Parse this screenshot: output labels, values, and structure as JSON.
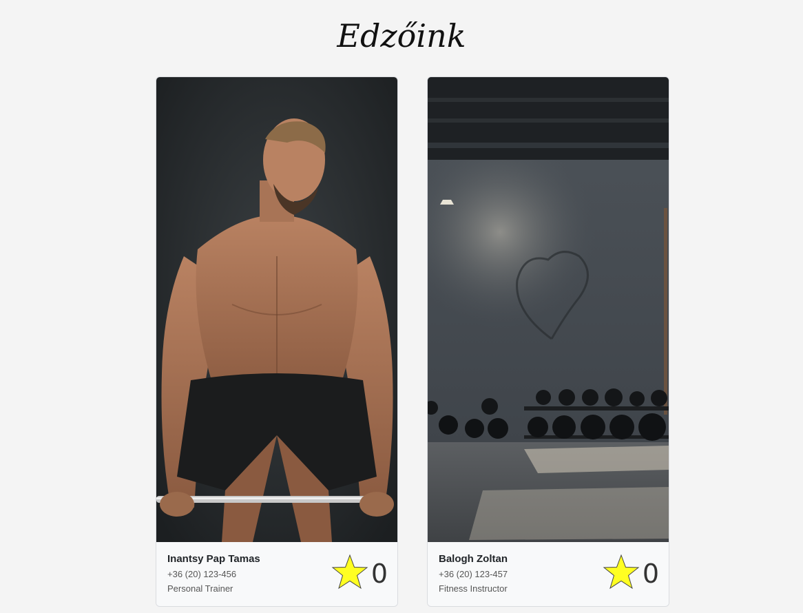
{
  "page": {
    "title": "Edzőink"
  },
  "trainers": [
    {
      "name": "Inantsy Pap Tamas",
      "phone": "+36 (20) 123-456",
      "role": "Personal Trainer",
      "rating": "0",
      "photo_icon": "trainer-photo-barbell",
      "star_color": "#ffff22"
    },
    {
      "name": "Balogh Zoltan",
      "phone": "+36 (20) 123-457",
      "role": "Fitness Instructor",
      "rating": "0",
      "photo_icon": "gym-interior-photo",
      "star_color": "#ffff22"
    }
  ]
}
